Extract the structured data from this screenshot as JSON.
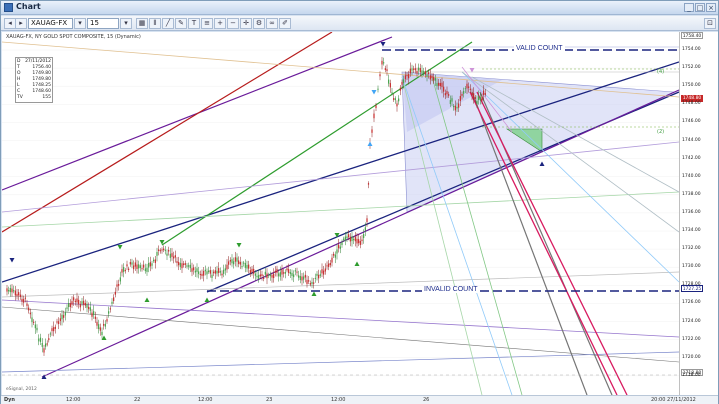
{
  "window": {
    "title": "Chart"
  },
  "toolbar": {
    "symbol": "XAUAG-FX",
    "timeframe": "15",
    "icons": [
      "grid-icon",
      "bars-icon",
      "line-icon",
      "draw-icon",
      "text-icon",
      "fib-icon",
      "zoom-in-icon",
      "zoom-out-icon",
      "crosshair-icon",
      "settings-icon",
      "link-icon",
      "edit-icon"
    ]
  },
  "chart_header": "XAUAG-FX, NY GOLD SPOT COMPOSITE, 15 (Dynamic)",
  "ohlc_box": {
    "rows": [
      {
        "k": "D",
        "v": "27/11/2012"
      },
      {
        "k": "T",
        "v": "1756.40"
      },
      {
        "k": "O",
        "v": "1749.80"
      },
      {
        "k": "H",
        "v": "1749.80"
      },
      {
        "k": "L",
        "v": "1748.25"
      },
      {
        "k": "C",
        "v": "1748.60"
      },
      {
        "k": "TV",
        "v": "155"
      }
    ]
  },
  "annotations": {
    "valid_count": "VALID COUNT",
    "invalid_count": "INVALID COUNT",
    "green_upper": "(4)",
    "green_lower": "(2)"
  },
  "watermark": "eSignal, 2012",
  "price_axis": {
    "labels": [
      "1756.40",
      "1754.00",
      "1752.00",
      "1750.00",
      "1748.00",
      "1746.00",
      "1744.00",
      "1742.00",
      "1740.00",
      "1738.00",
      "1736.00",
      "1734.00",
      "1732.00",
      "1730.00",
      "1728.00",
      "1726.00",
      "1724.00",
      "1722.00",
      "1720.00",
      "1718.00"
    ],
    "current_price": "1748.80",
    "top_marker": "1758.40",
    "low_marker": "1718.80",
    "invalid_marker": "1727.25"
  },
  "time_axis": {
    "left_label": "Dyn",
    "labels": [
      "12:00",
      "22",
      "12:00",
      "23",
      "12:00",
      "26"
    ],
    "right_label": "20:00 27/11/2012"
  },
  "colors": {
    "background": "#ffffff",
    "candle_up": "#2e7d32",
    "candle_down": "#b71c1c",
    "accent_blue": "#1a237e",
    "current_price_bg": "#c62828"
  }
}
